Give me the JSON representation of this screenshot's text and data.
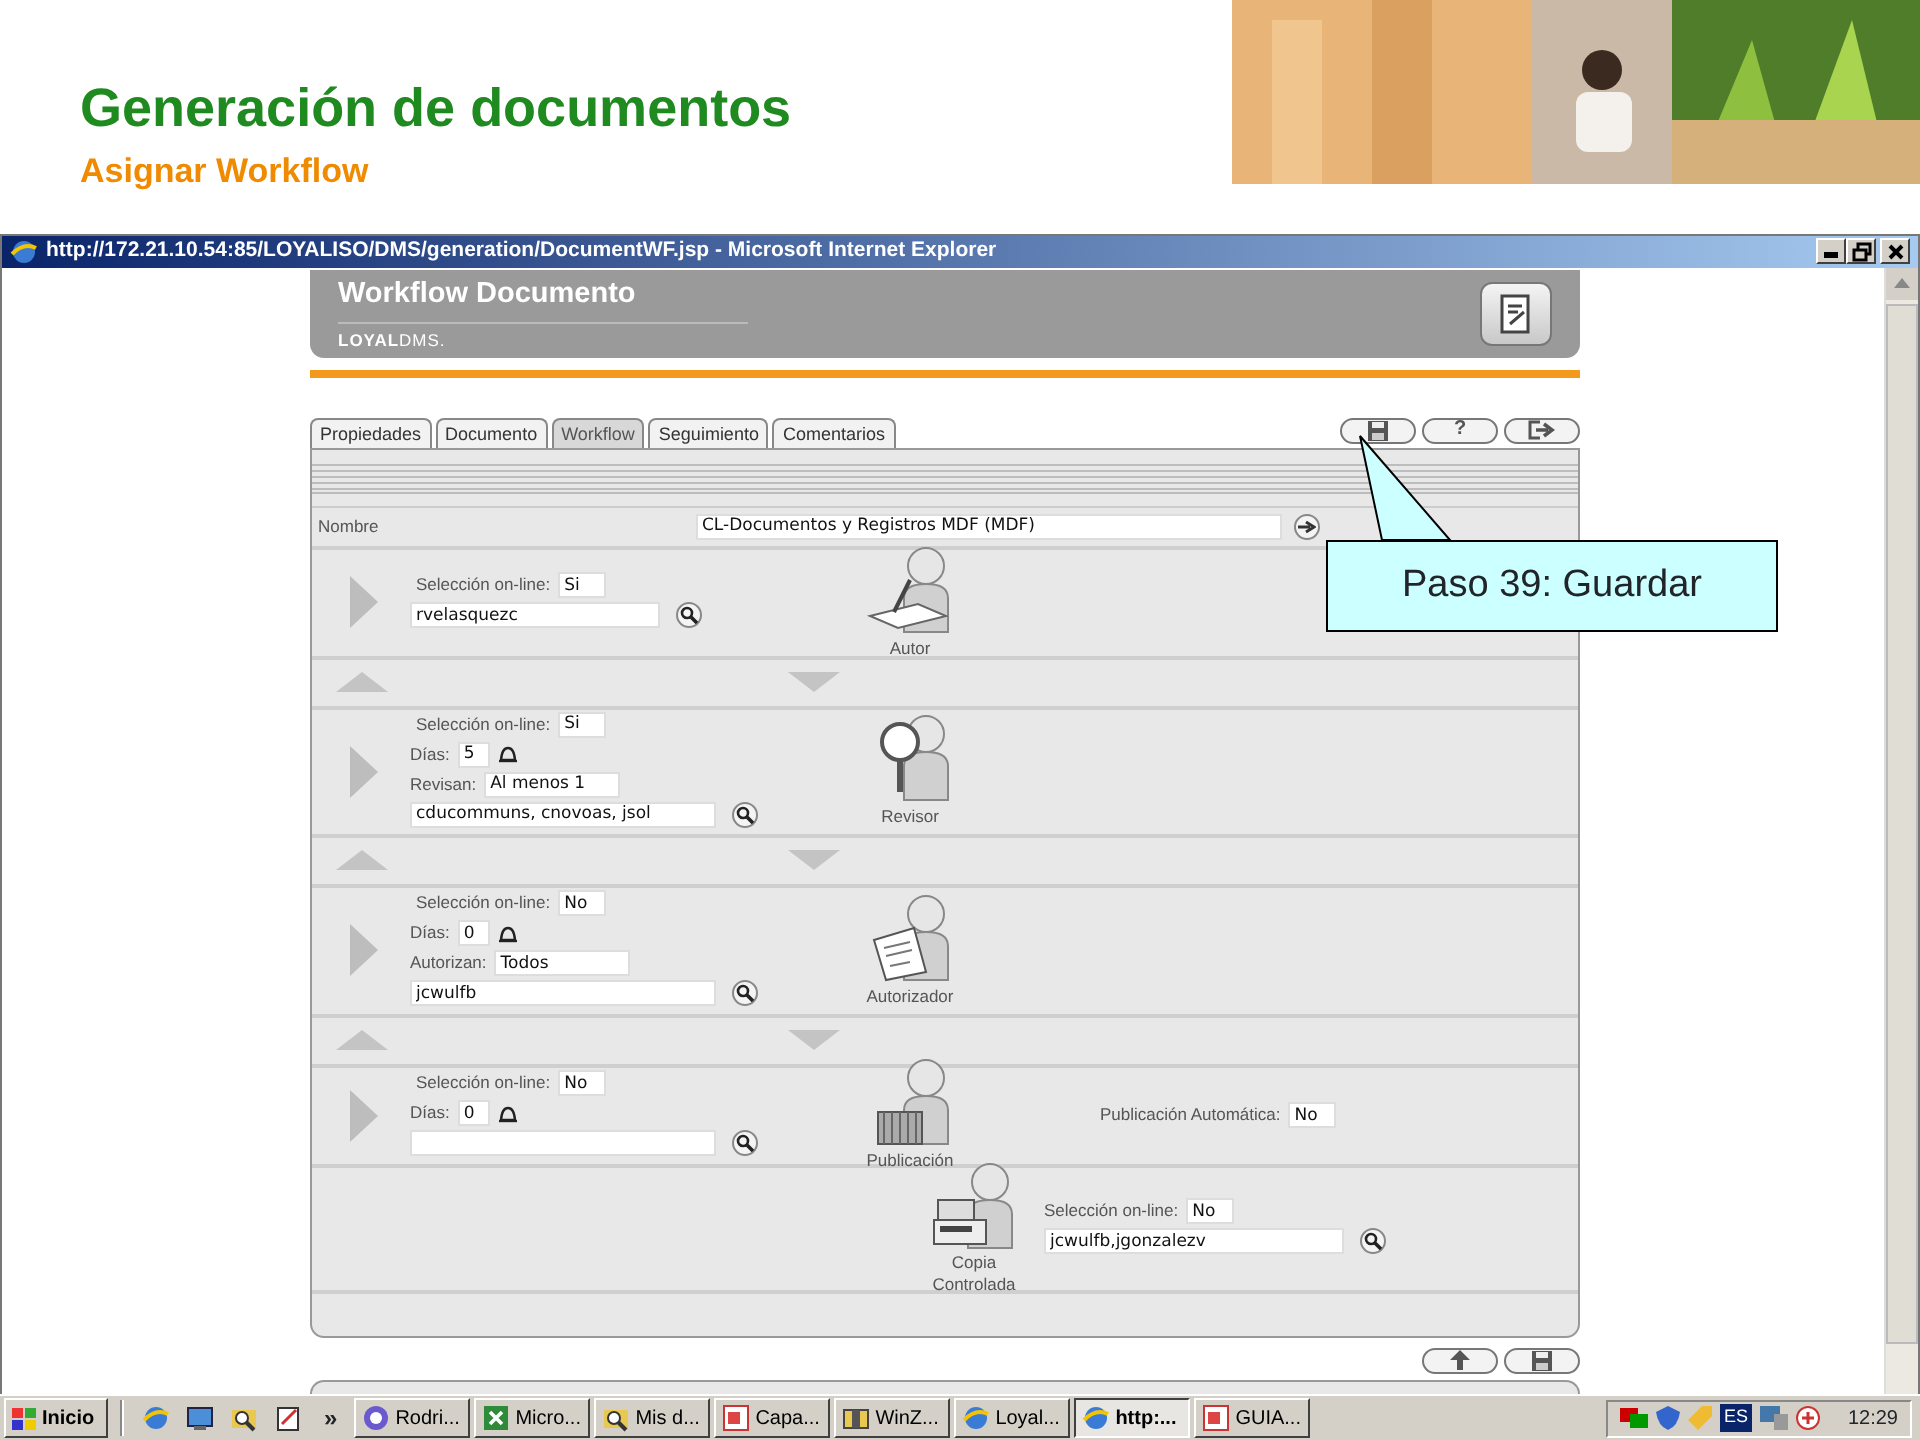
{
  "slide": {
    "title": "Generación de documentos",
    "subtitle": "Asignar Workflow"
  },
  "browser": {
    "title": "http://172.21.10.54:85/LOYALISO/DMS/generation/DocumentWF.jsp - Microsoft Internet Explorer"
  },
  "header": {
    "title": "Workflow Documento",
    "brand": "**LOYAL**DMS."
  },
  "tabs": [
    {
      "label": "Propiedades",
      "selected": false
    },
    {
      "label": "Documento",
      "selected": false
    },
    {
      "label": "Workflow",
      "selected": true
    },
    {
      "label": "Seguimiento",
      "selected": false
    },
    {
      "label": "Comentarios",
      "selected": false
    }
  ],
  "toolbar": [
    {
      "kind": "save"
    },
    {
      "kind": "help",
      "label": "?"
    },
    {
      "kind": "exit"
    }
  ],
  "nombre": {
    "label": "Nombre",
    "value": "CL-Documentos y Registros MDF (MDF)"
  },
  "stages": [
    {
      "kind": "autor",
      "role": "Autor",
      "online_label": "Selección on-line:",
      "online": "Si",
      "users": "rvelasquezc",
      "reorder": true
    },
    {
      "kind": "revisor",
      "role": "Revisor",
      "online_label": "Selección on-line:",
      "online": "Si",
      "days_label": "Días:",
      "days": "5",
      "quorum_label": "Revisan:",
      "quorum": "Al menos 1",
      "users": "cducommuns, cnovoas, jsol",
      "reorder": true
    },
    {
      "kind": "autorizador",
      "role": "Autorizador",
      "online_label": "Selección on-line:",
      "online": "No",
      "days_label": "Días:",
      "days": "0",
      "quorum_label": "Autorizan:",
      "quorum": "Todos",
      "users": "jcwulfb",
      "reorder": true
    },
    {
      "kind": "publicacion",
      "role": "Publicación",
      "online_label": "Selección on-line:",
      "online": "No",
      "days_label": "Días:",
      "days": "0",
      "auto_label": "Publicación Automática:",
      "auto": "No",
      "reorder": false
    },
    {
      "kind": "copia",
      "role": "Copia Controlada",
      "online_label": "Selección on-line:",
      "online": "No",
      "users": "jcwulfb,jgonzalezv",
      "reorder": false
    }
  ],
  "bottom_buttons": [
    {
      "kind": "up"
    },
    {
      "kind": "save"
    }
  ],
  "callout": {
    "text": "Paso 39: Guardar"
  },
  "taskbar": {
    "start": "Inicio",
    "quick_launch": [
      {
        "kind": "browser"
      },
      {
        "kind": "desktop"
      },
      {
        "kind": "search"
      },
      {
        "kind": "notes"
      }
    ],
    "more": "»",
    "tasks": [
      {
        "kind": "globe",
        "label": "Rodri...",
        "selected": false
      },
      {
        "kind": "sheet",
        "label": "Micro...",
        "selected": false
      },
      {
        "kind": "search",
        "label": "Mis d...",
        "selected": false
      },
      {
        "kind": "slides",
        "label": "Capa...",
        "selected": false
      },
      {
        "kind": "archive",
        "label": "WinZ...",
        "selected": false
      },
      {
        "kind": "browser",
        "label": "Loyal...",
        "selected": false
      },
      {
        "kind": "browser",
        "label": "http:...",
        "selected": true
      },
      {
        "kind": "slides",
        "label": "GUIA...",
        "selected": false
      }
    ],
    "language": "ES",
    "clock": "12:29"
  }
}
